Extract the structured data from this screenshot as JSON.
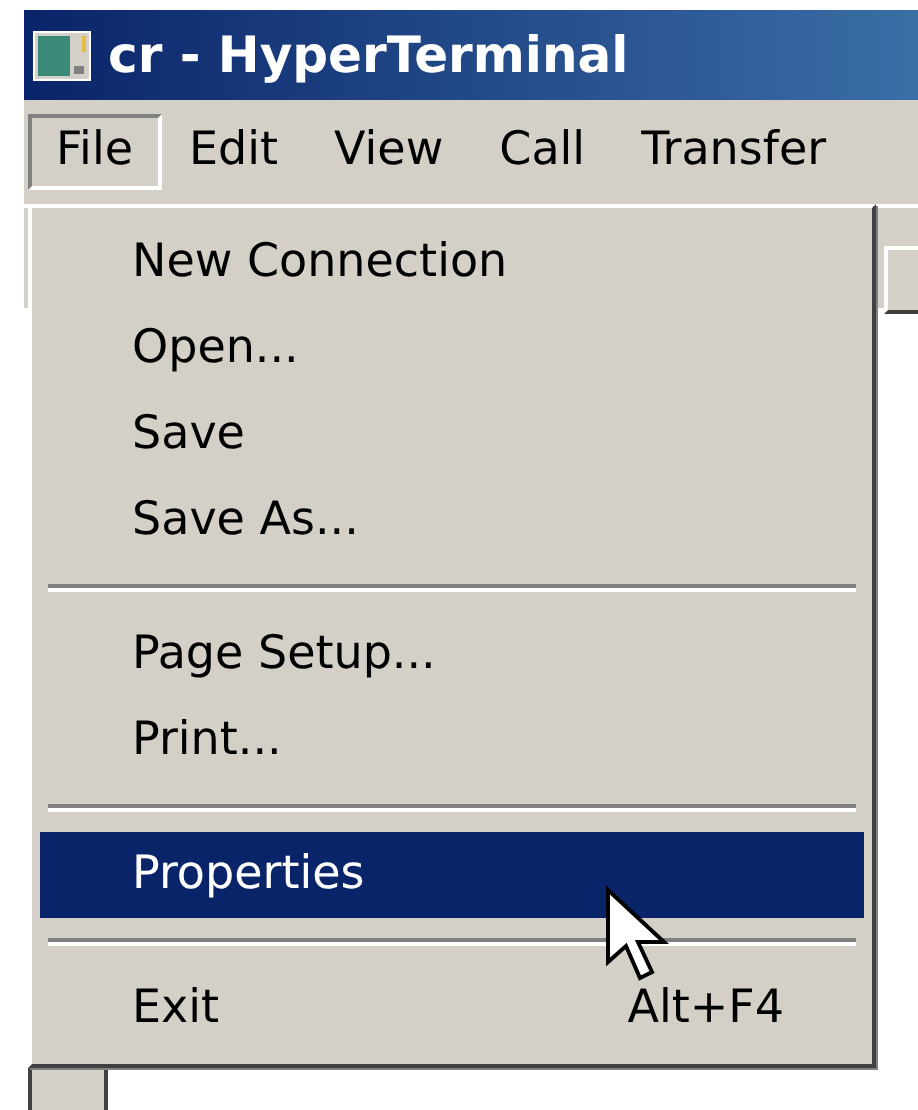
{
  "window": {
    "title": "cr - HyperTerminal"
  },
  "menubar": [
    {
      "label": "File",
      "selected": true
    },
    {
      "label": "Edit",
      "selected": false
    },
    {
      "label": "View",
      "selected": false
    },
    {
      "label": "Call",
      "selected": false
    },
    {
      "label": "Transfer",
      "selected": false
    }
  ],
  "file_menu": [
    {
      "kind": "item",
      "label": "New Connection",
      "selected": false
    },
    {
      "kind": "item",
      "label": "Open...",
      "selected": false
    },
    {
      "kind": "item",
      "label": "Save",
      "selected": false
    },
    {
      "kind": "item",
      "label": "Save As...",
      "selected": false
    },
    {
      "kind": "separator"
    },
    {
      "kind": "item",
      "label": "Page Setup...",
      "selected": false
    },
    {
      "kind": "item",
      "label": "Print...",
      "selected": false
    },
    {
      "kind": "separator"
    },
    {
      "kind": "item",
      "label": "Properties",
      "selected": true
    },
    {
      "kind": "separator"
    },
    {
      "kind": "item",
      "label": "Exit",
      "shortcut": "Alt+F4",
      "selected": false
    }
  ]
}
